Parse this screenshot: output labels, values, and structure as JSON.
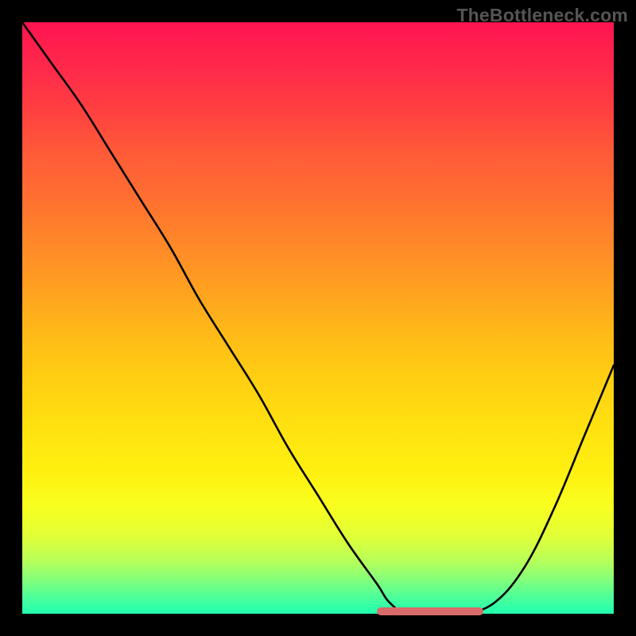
{
  "watermark": "TheBottleneck.com",
  "chart_data": {
    "type": "line",
    "title": "",
    "xlabel": "",
    "ylabel": "",
    "xlim": [
      0,
      100
    ],
    "ylim": [
      0,
      100
    ],
    "grid": false,
    "series": [
      {
        "name": "curve",
        "x": [
          0,
          5,
          10,
          15,
          20,
          25,
          30,
          35,
          40,
          45,
          50,
          55,
          60,
          62,
          65,
          70,
          75,
          80,
          85,
          90,
          95,
          100
        ],
        "y": [
          100,
          93,
          86,
          78,
          70,
          62,
          53,
          45,
          37,
          28,
          20,
          12,
          5,
          2,
          0,
          0,
          0,
          2,
          8,
          18,
          30,
          42
        ]
      }
    ],
    "markers": {
      "name": "highlight-band",
      "color": "#d86a6a",
      "x_start": 60,
      "x_end": 78,
      "y": 0
    },
    "background": {
      "type": "vertical-gradient",
      "stops": [
        {
          "pos": 0,
          "color": "#ff1450"
        },
        {
          "pos": 50,
          "color": "#ffb818"
        },
        {
          "pos": 80,
          "color": "#fff010"
        },
        {
          "pos": 100,
          "color": "#20ffb0"
        }
      ]
    }
  }
}
